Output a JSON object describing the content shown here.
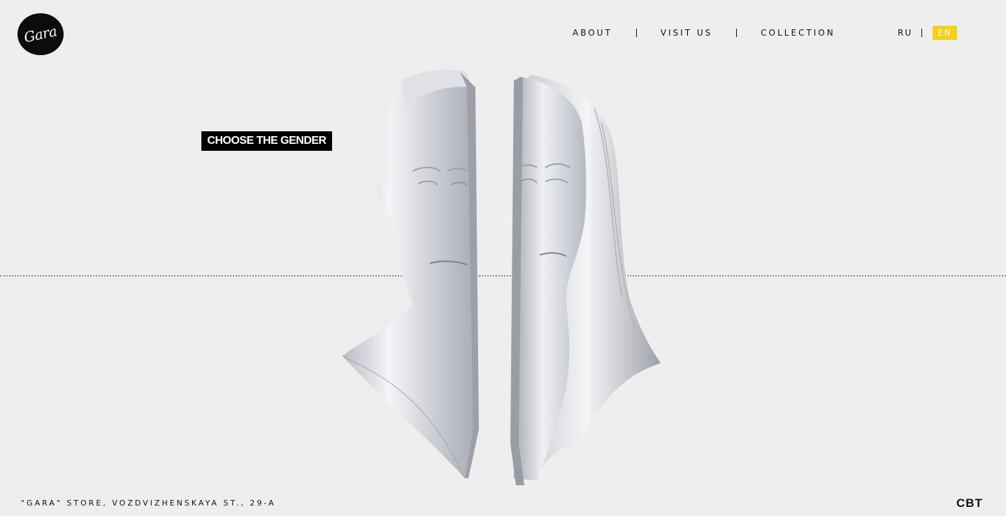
{
  "logo": {
    "text": "Gara"
  },
  "nav": {
    "items": [
      {
        "label": "ABOUT"
      },
      {
        "label": "VISIT US"
      },
      {
        "label": "COLLECTION"
      }
    ]
  },
  "lang": {
    "ru": "RU",
    "en": "EN",
    "active": "EN",
    "active_color": "#f2d21a"
  },
  "hero": {
    "cta": "CHOOSE THE GENDER"
  },
  "footer": {
    "address": "\"GARA\" STORE, VOZDVIZHENSKAYA ST., 29-A",
    "brand": "CBT"
  },
  "icons": {
    "male": "male-bust-icon",
    "female": "female-bust-icon"
  }
}
